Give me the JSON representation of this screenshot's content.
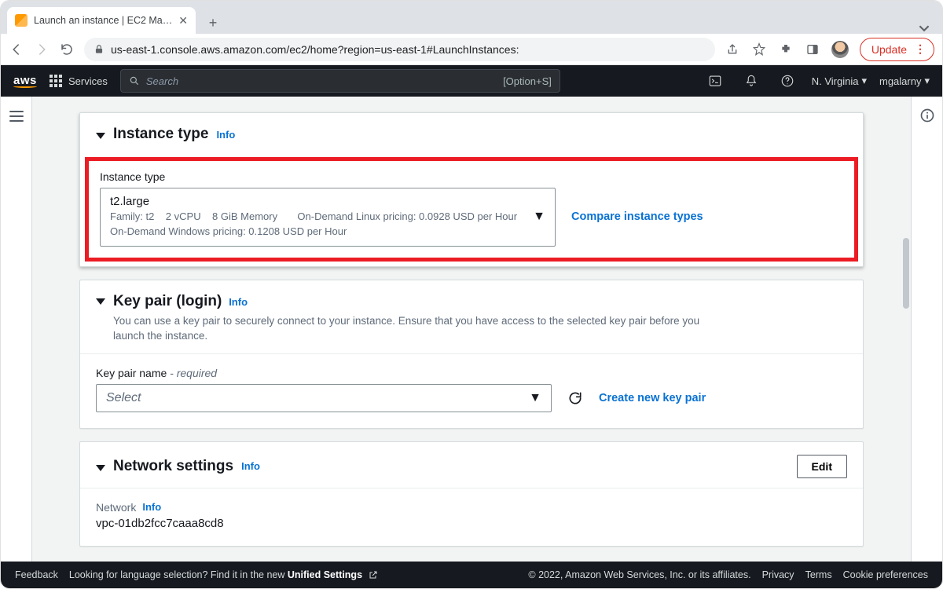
{
  "browser": {
    "tab_title": "Launch an instance | EC2 Mana",
    "url": "us-east-1.console.aws.amazon.com/ec2/home?region=us-east-1#LaunchInstances:",
    "update_label": "Update"
  },
  "nav": {
    "services": "Services",
    "search_placeholder": "Search",
    "search_kbd": "[Option+S]",
    "region": "N. Virginia",
    "user": "mgalarny"
  },
  "instance_type": {
    "section_title": "Instance type",
    "info": "Info",
    "field_label": "Instance type",
    "selected": {
      "name": "t2.large",
      "family": "Family: t2",
      "vcpu": "2 vCPU",
      "memory": "8 GiB Memory",
      "linux_price": "On-Demand Linux pricing: 0.0928 USD per Hour",
      "windows_price": "On-Demand Windows pricing: 0.1208 USD per Hour"
    },
    "compare_link": "Compare instance types"
  },
  "key_pair": {
    "section_title": "Key pair (login)",
    "info": "Info",
    "description": "You can use a key pair to securely connect to your instance. Ensure that you have access to the selected key pair before you launch the instance.",
    "field_label": "Key pair name",
    "required": "- required",
    "placeholder": "Select",
    "create_link": "Create new key pair"
  },
  "network": {
    "section_title": "Network settings",
    "info": "Info",
    "edit": "Edit",
    "network_label": "Network",
    "network_info": "Info",
    "vpc": "vpc-01db2fcc7caaa8cd8"
  },
  "footer": {
    "feedback": "Feedback",
    "lang_prompt": "Looking for language selection? Find it in the new ",
    "lang_link": "Unified Settings",
    "copyright": "© 2022, Amazon Web Services, Inc. or its affiliates.",
    "privacy": "Privacy",
    "terms": "Terms",
    "cookies": "Cookie preferences"
  }
}
